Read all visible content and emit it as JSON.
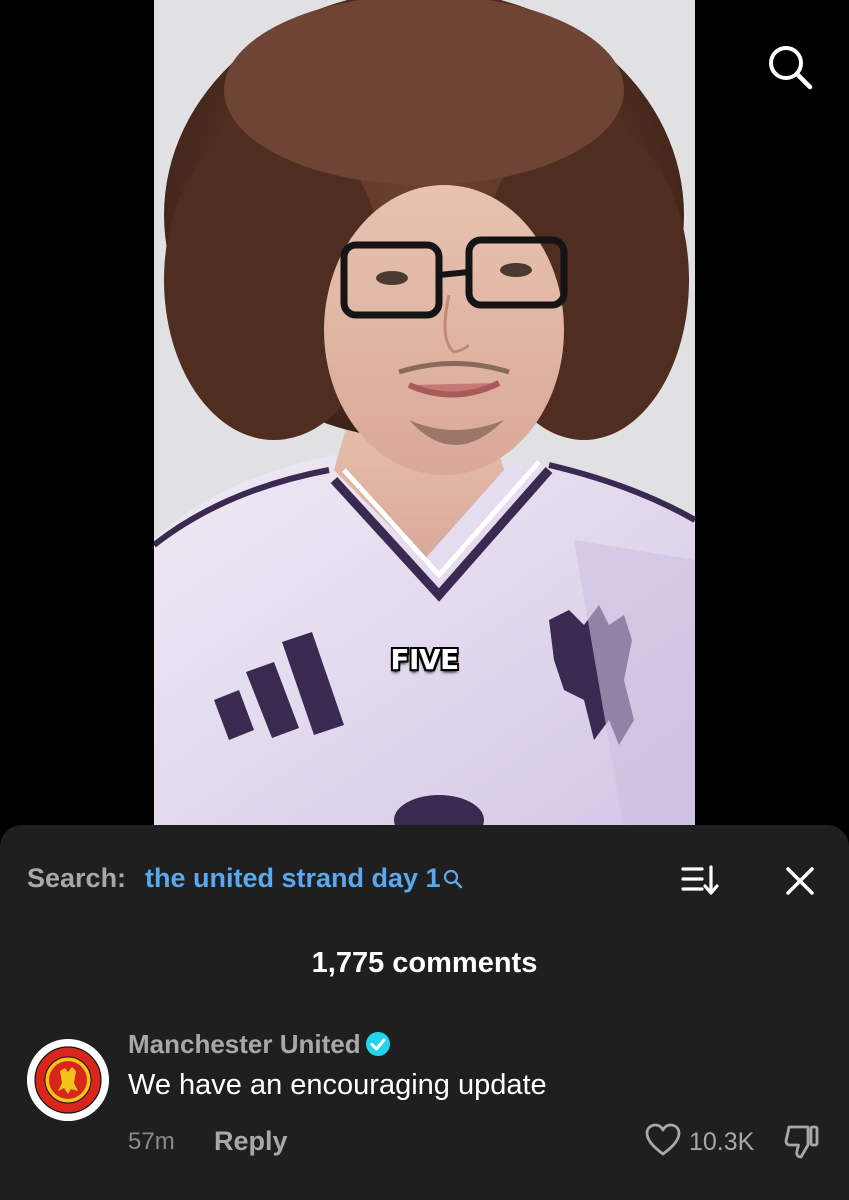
{
  "video": {
    "caption": "FIVE"
  },
  "top_bar": {
    "search_icon": "search-icon"
  },
  "comments_panel": {
    "search_label": "Search:",
    "search_query": "the united strand day 1",
    "sort_icon": "sort-icon",
    "close_icon": "close-icon",
    "comment_count": "1,775 comments",
    "comments": [
      {
        "author": "Manchester United",
        "verified": true,
        "text": "We have an encouraging update",
        "time": "57m",
        "reply_label": "Reply",
        "likes": "10.3K",
        "avatar_icon": "club-crest-avatar"
      }
    ]
  },
  "colors": {
    "sheet_bg": "#1f1f1f",
    "link_blue": "#5aa8f0",
    "verified_cyan": "#20d5ec",
    "muted_text": "#a8a8a8"
  }
}
